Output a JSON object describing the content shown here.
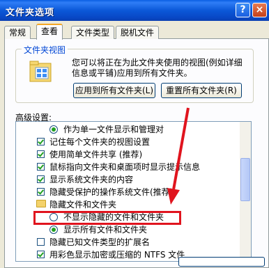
{
  "window": {
    "title": "文件夹选项",
    "help_label": "?",
    "close_label": "×"
  },
  "tabs": [
    "常规",
    "查看",
    "文件类型",
    "脱机文件"
  ],
  "folder_view": {
    "group_label": "文件夹视图",
    "description": "您可以将正在为此文件夹使用的视图(例如详细信息或平铺)应用到所有文件夹。",
    "apply_button": "应用到所有文件夹(L)",
    "reset_button": "重置所有文件夹(R)"
  },
  "advanced": {
    "label": "高级设置:",
    "items": [
      {
        "type": "radio",
        "checked": true,
        "indent": 2,
        "label": "作为单一文件显示和管理对"
      },
      {
        "type": "check",
        "checked": true,
        "indent": 1,
        "label": "记住每个文件夹的视图设置"
      },
      {
        "type": "check",
        "checked": true,
        "indent": 1,
        "label": "使用简单文件共享 (推荐)"
      },
      {
        "type": "check",
        "checked": true,
        "indent": 1,
        "label": "鼠标指向文件夹和桌面项时显示提示信息"
      },
      {
        "type": "check",
        "checked": true,
        "indent": 1,
        "label": "显示系统文件夹的内容"
      },
      {
        "type": "check",
        "checked": true,
        "indent": 1,
        "label": "隐藏受保护的操作系统文件(推荐)"
      },
      {
        "type": "folder",
        "checked": false,
        "indent": 1,
        "label": "隐藏文件和文件夹"
      },
      {
        "type": "radio",
        "checked": false,
        "indent": 2,
        "label": "不显示隐藏的文件和文件夹"
      },
      {
        "type": "radio",
        "checked": true,
        "indent": 2,
        "label": "显示所有文件和文件夹"
      },
      {
        "type": "check",
        "checked": false,
        "indent": 1,
        "label": "隐藏已知文件类型的扩展名"
      },
      {
        "type": "check",
        "checked": true,
        "indent": 1,
        "label": "用彩色显示加密或压缩的 NTFS 文件"
      }
    ]
  },
  "colors": {
    "titlebar": "#0a58d8",
    "highlight": "#e0141e",
    "check": "#21a121"
  }
}
